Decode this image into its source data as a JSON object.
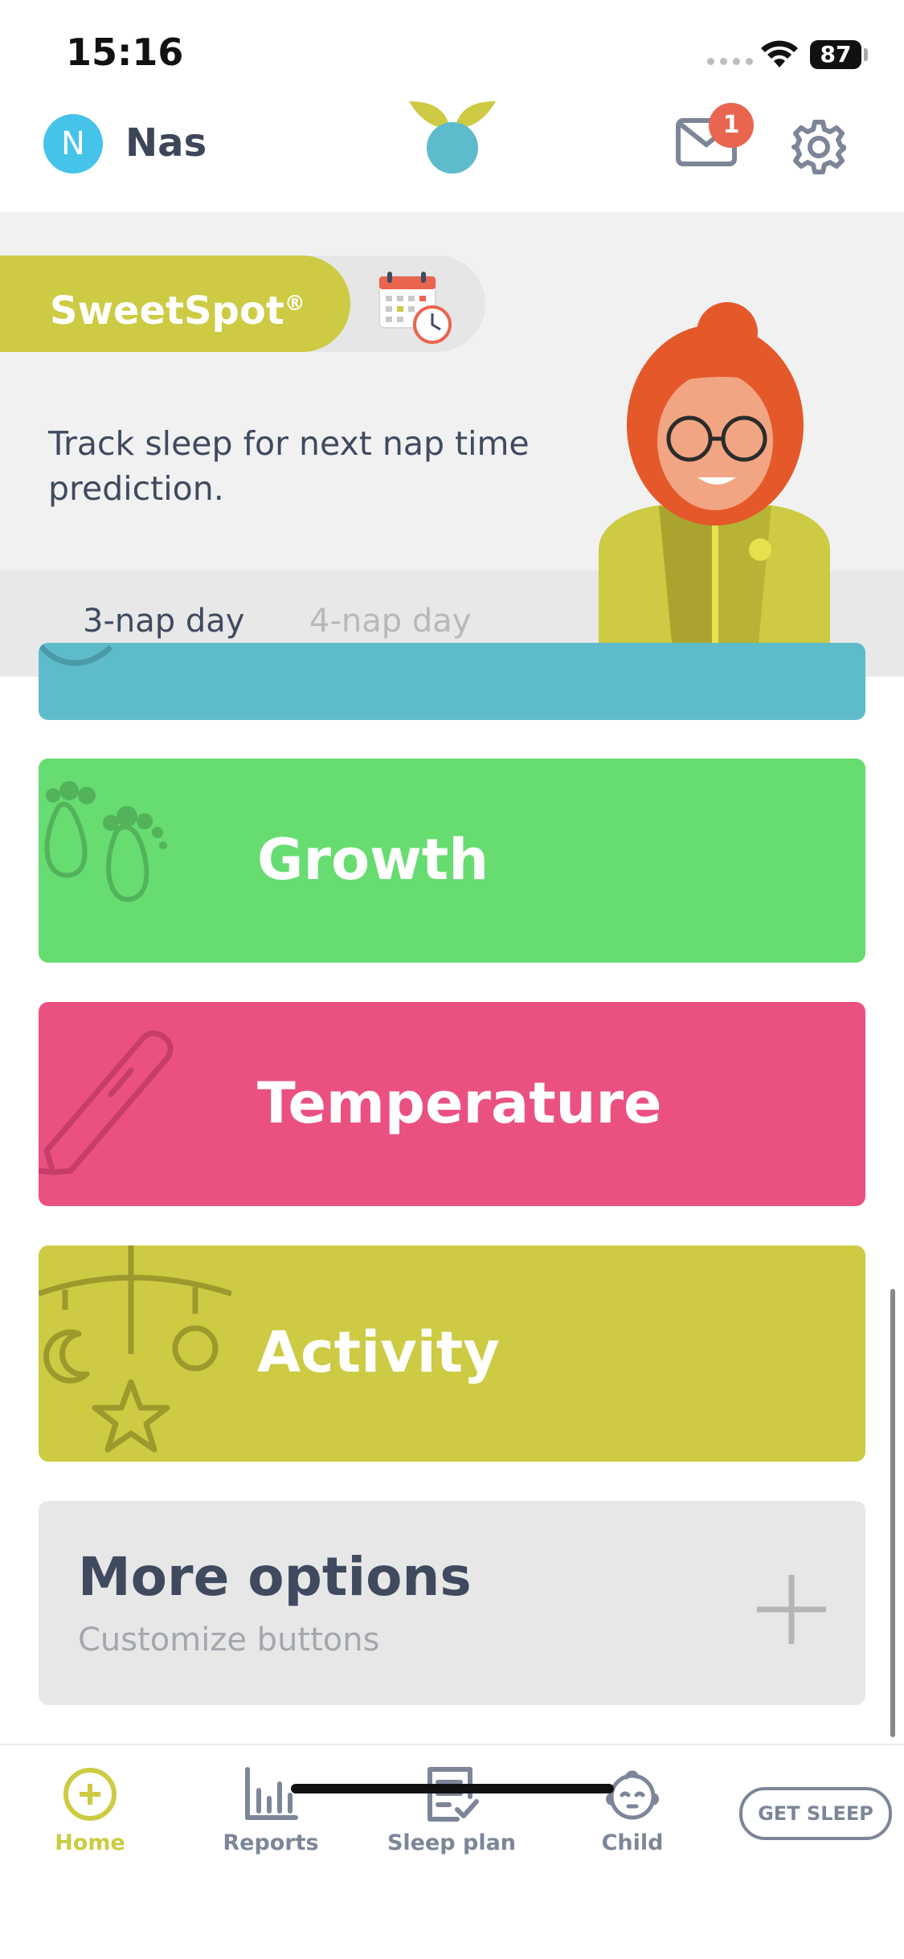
{
  "status_bar": {
    "time": "15:16",
    "battery": "87"
  },
  "header": {
    "avatar_initial": "N",
    "username": "Nas",
    "notification_count": "1"
  },
  "sweetspot": {
    "title": "SweetSpot",
    "trademark": "®",
    "description": "Track sleep for next nap time prediction.",
    "tabs": [
      {
        "label": "3-nap day",
        "active": true
      },
      {
        "label": "4-nap day",
        "active": false
      }
    ]
  },
  "actions": [
    {
      "label": "Growth",
      "color": "#67dc70",
      "icon": "footprints-icon"
    },
    {
      "label": "Temperature",
      "color": "#ea5181",
      "icon": "thermometer-icon"
    },
    {
      "label": "Activity",
      "color": "#cccb43",
      "icon": "baby-mobile-icon"
    }
  ],
  "more_options": {
    "title": "More options",
    "subtitle": "Customize buttons"
  },
  "nav": {
    "items": [
      {
        "label": "Home",
        "icon": "home-plus-icon",
        "active": true
      },
      {
        "label": "Reports",
        "icon": "bar-chart-icon",
        "active": false
      },
      {
        "label": "Sleep plan",
        "icon": "sleep-plan-icon",
        "active": false
      },
      {
        "label": "Child",
        "icon": "child-face-icon",
        "active": false
      }
    ],
    "get_sleep": "GET SLEEP"
  },
  "colors": {
    "accent": "#cccb43",
    "teal": "#5ebbcb",
    "text": "#3f4a5f",
    "badge": "#e9654f"
  }
}
